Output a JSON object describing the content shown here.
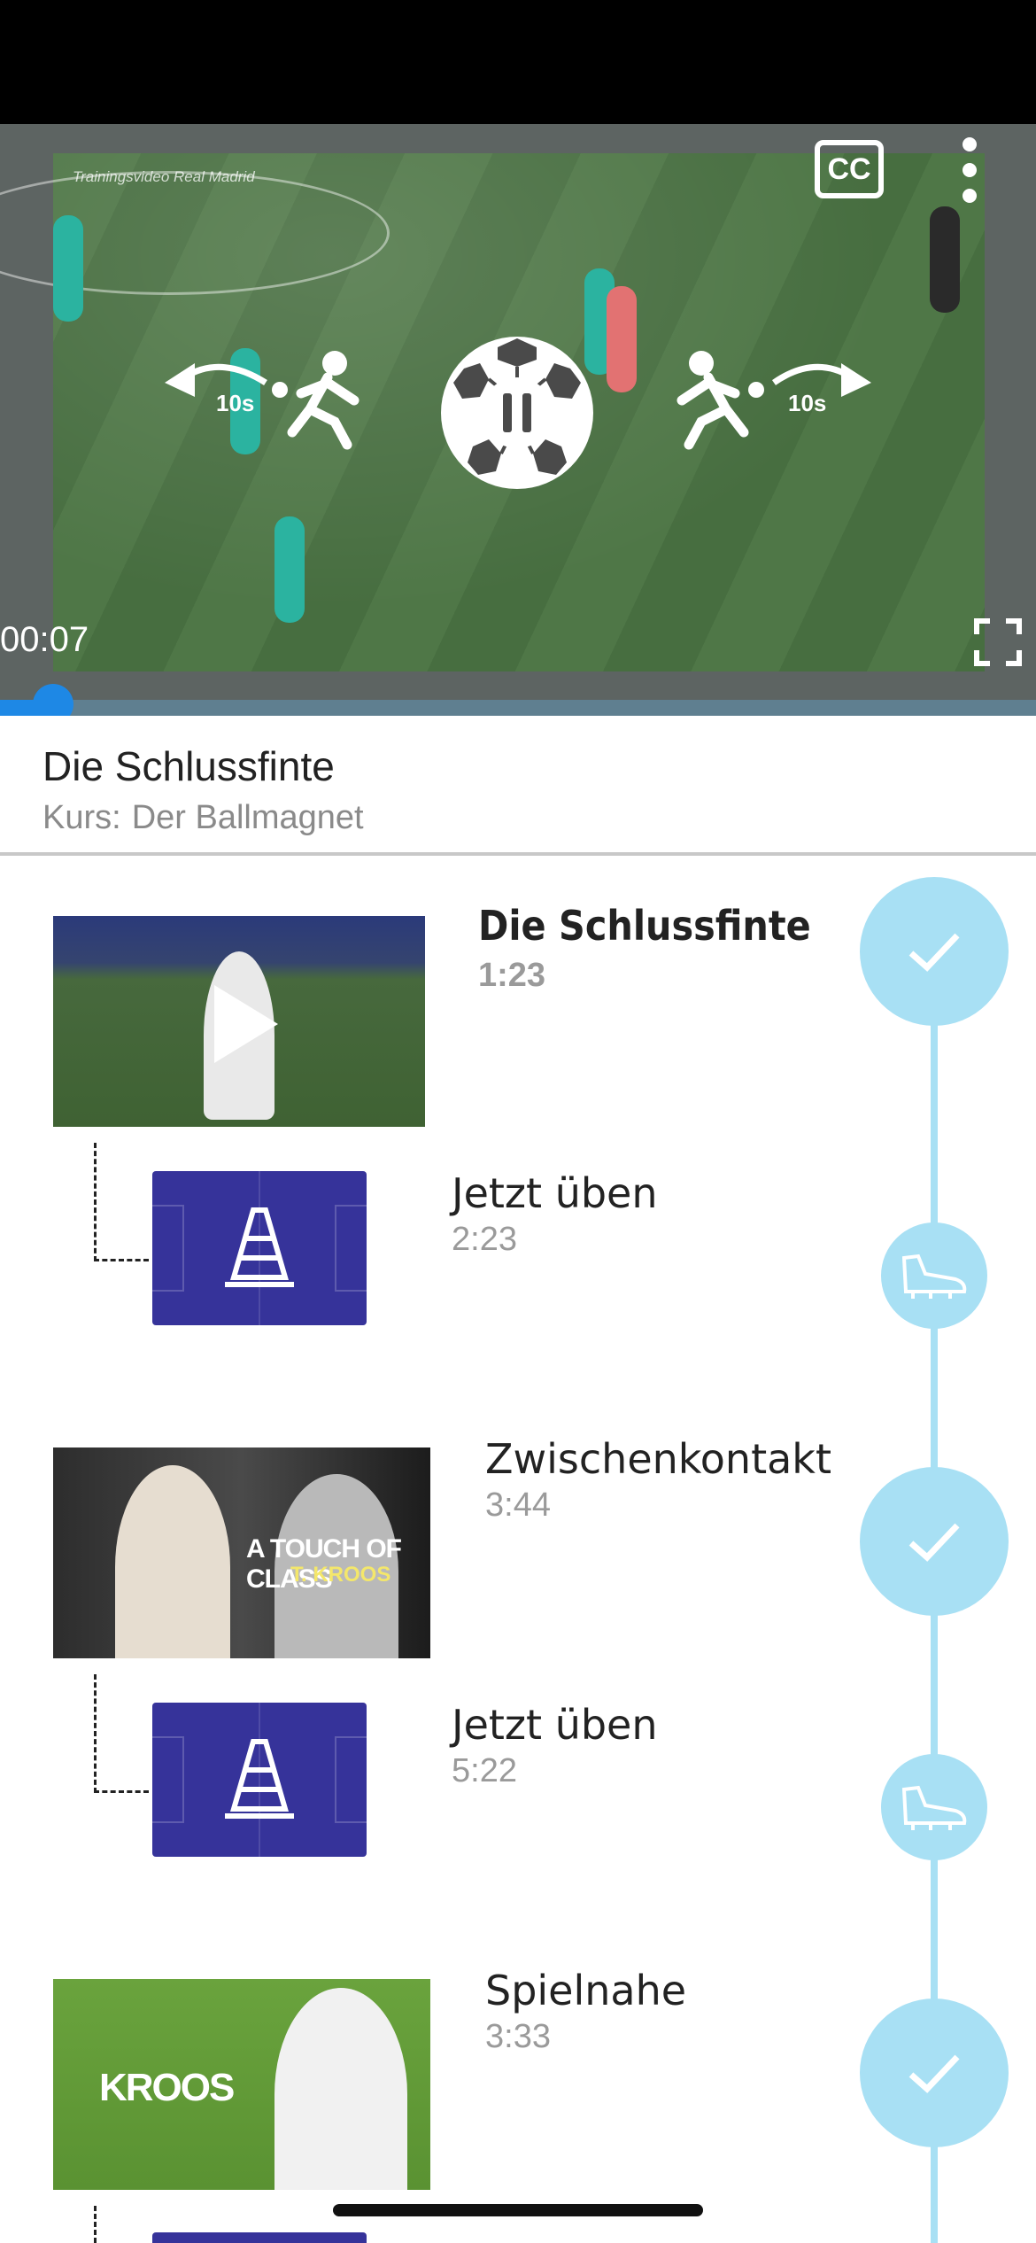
{
  "player": {
    "watermark": "Trainingsvideo Real Madrid",
    "cc_label": "CC",
    "skip_back_label": "10s",
    "skip_forward_label": "10s",
    "current_time": "00:07",
    "progress": 0.03
  },
  "info": {
    "title": "Die Schlussfinte",
    "course_prefix": "Kurs:",
    "course_name": "Der Ballmagnet"
  },
  "lessons": [
    {
      "title": "Die Schlussfinte",
      "duration": "1:23",
      "active": true,
      "exercise": {
        "title": "Jetzt üben",
        "duration": "2:23"
      }
    },
    {
      "title": "Zwischenkontakt",
      "duration": "3:44",
      "thumb_caption": "A TOUCH OF CLASS",
      "thumb_sub": "T. KROOS",
      "exercise": {
        "title": "Jetzt üben",
        "duration": "5:22"
      }
    },
    {
      "title": "Spielnahe",
      "duration": "3:33",
      "thumb_caption": "KROOS"
    }
  ],
  "colors": {
    "timeline": "#a8e0f4",
    "progress": "#1e88e5",
    "exercise_bg": "#36339a"
  }
}
